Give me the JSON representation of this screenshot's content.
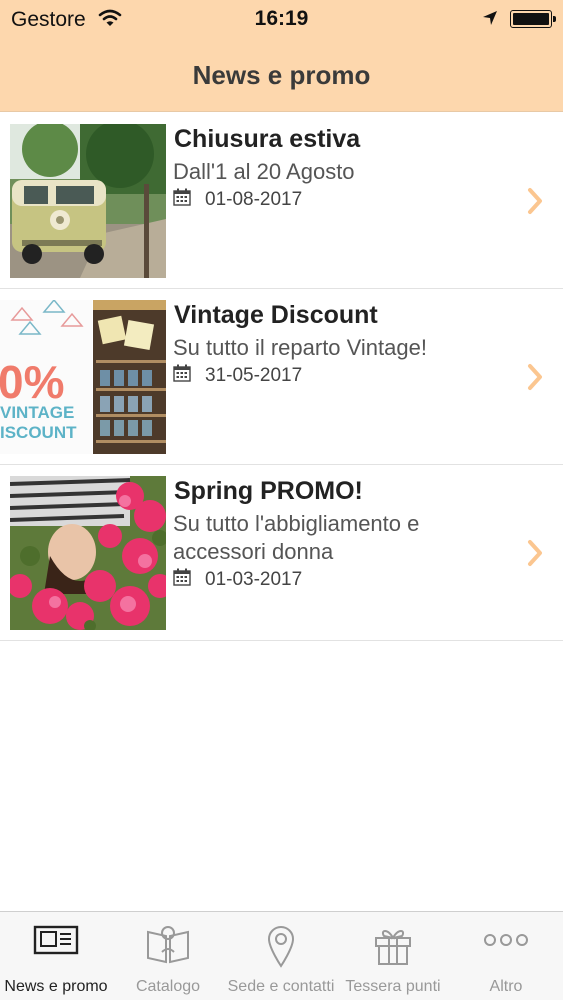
{
  "status_bar": {
    "carrier": "Gestore",
    "time": "16:19"
  },
  "header": {
    "title": "News e promo"
  },
  "news": [
    {
      "title": "Chiusura estiva",
      "subtitle": "Dall'1 al 20 Agosto",
      "date": "01-08-2017",
      "image": "van-photo"
    },
    {
      "title": "Vintage Discount",
      "subtitle": "Su tutto il reparto Vintage!",
      "date": "31-05-2017",
      "image": "vintage-discount-banner",
      "banner_text": {
        "percent": "0%",
        "line1": "VINTAGE",
        "line2": "ISCOUNT"
      }
    },
    {
      "title": "Spring PROMO!",
      "subtitle": "Su tutto l'abbigliamento e accessori donna",
      "date": "01-03-2017",
      "image": "flowers-photo"
    }
  ],
  "tabbar": {
    "items": [
      {
        "label": "News e promo",
        "icon": "newspaper-icon",
        "active": true
      },
      {
        "label": "Catalogo",
        "icon": "book-icon",
        "active": false
      },
      {
        "label": "Sede e contatti",
        "icon": "map-pin-icon",
        "active": false
      },
      {
        "label": "Tessera punti",
        "icon": "gift-icon",
        "active": false
      },
      {
        "label": "Altro",
        "icon": "more-icon",
        "active": false
      }
    ]
  },
  "colors": {
    "header_bg": "#fdd7ad",
    "chevron": "#fbc690",
    "active_tab": "#222222",
    "inactive_tab": "#999999"
  }
}
